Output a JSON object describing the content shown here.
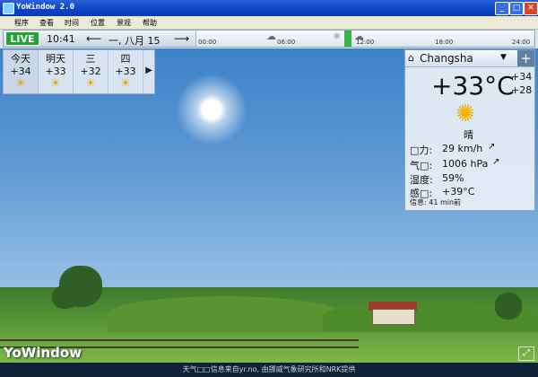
{
  "window": {
    "title": "YoWindow 2.0",
    "minimize": "_",
    "maximize": "□",
    "close": "✕"
  },
  "menu": {
    "items": [
      "程序",
      "查看",
      "时间",
      "位置",
      "景观",
      "帮助"
    ]
  },
  "toolbar": {
    "live_label": "LIVE",
    "time": "10:41",
    "prev_icon": "arrow-left-icon",
    "date": "一, 八月 15",
    "next_icon": "arrow-right-icon",
    "timeline_ticks": [
      "00:00",
      "06:00",
      "12:00",
      "18:00",
      "24:00"
    ],
    "marker_label": "•"
  },
  "forecast": {
    "days": [
      {
        "name": "今天",
        "temp": "+34",
        "icon": "partly-cloudy-icon"
      },
      {
        "name": "明天",
        "temp": "+33",
        "icon": "sun-icon"
      },
      {
        "name": "三",
        "temp": "+32",
        "icon": "sun-icon"
      },
      {
        "name": "四",
        "temp": "+33",
        "icon": "sun-icon"
      }
    ],
    "more_label": "▶"
  },
  "current": {
    "city": "Changsha",
    "temperature": "+33°C",
    "high": "+34",
    "low": "+28",
    "condition": "晴",
    "condition_icon": "sun-icon",
    "wind_label": "□力:",
    "wind_value": "29 km/h",
    "pressure_label": "气□:",
    "pressure_value": "1006 hPa",
    "humidity_label": "湿度:",
    "humidity_value": "59%",
    "feels_label": "感□:",
    "feels_value": "+39°C",
    "info": "信息: 41 min前"
  },
  "brand": {
    "logo": "YoWindow"
  },
  "footer": {
    "credit": "天气□□信息来自yr.no, 由挪威气象研究所和NRK提供"
  },
  "colors": {
    "live": "#22a334",
    "titlebar": "#0b43c7",
    "sky": "#3c82c8"
  }
}
